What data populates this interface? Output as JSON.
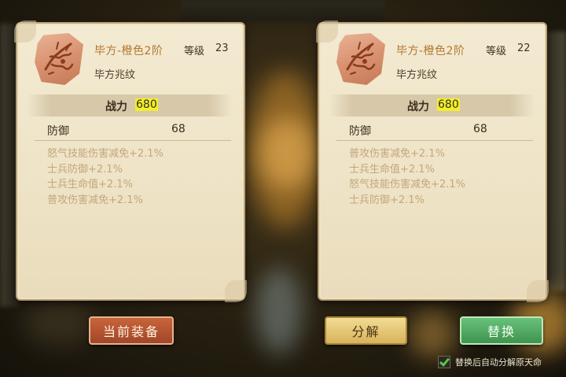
{
  "colors": {
    "panel_bg": "#f0e6cb",
    "name_text": "#b3772f",
    "attr_text": "#c3a77a",
    "power_highlight": "#f2ef2a",
    "equip_button": "#b4532f",
    "decompose_button": "#e4c777",
    "replace_button": "#53aa64",
    "checkbox_check": "#5ec04e"
  },
  "left_item": {
    "icon": "rune-stone-icon",
    "name": "毕方-橙色2阶",
    "level_label": "等级",
    "level": "23",
    "subtype": "毕方兆纹",
    "power_label": "战力",
    "power_value": "680",
    "stat_label": "防御",
    "stat_value": "68",
    "attributes": [
      "怒气技能伤害减免+2.1%",
      "士兵防御+2.1%",
      "士兵生命值+2.1%",
      "普攻伤害减免+2.1%"
    ]
  },
  "right_item": {
    "icon": "rune-stone-icon",
    "name": "毕方-橙色2阶",
    "level_label": "等级",
    "level": "22",
    "subtype": "毕方兆纹",
    "power_label": "战力",
    "power_value": "680",
    "stat_label": "防御",
    "stat_value": "68",
    "attributes": [
      "普攻伤害减免+2.1%",
      "士兵生命值+2.1%",
      "怒气技能伤害减免+2.1%",
      "士兵防御+2.1%"
    ]
  },
  "buttons": {
    "current_equip": "当前装备",
    "decompose": "分解",
    "replace": "替换"
  },
  "auto_decompose": {
    "checked": true,
    "label": "替换后自动分解原天命"
  }
}
